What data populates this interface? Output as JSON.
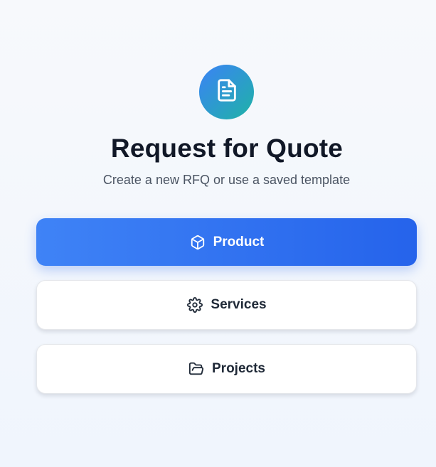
{
  "header": {
    "logo_icon": "document-icon",
    "title": "Request for Quote",
    "subtitle": "Create a new RFQ or use a saved template"
  },
  "options": [
    {
      "label": "Product",
      "icon": "package-icon",
      "style": "primary"
    },
    {
      "label": "Services",
      "icon": "gear-icon",
      "style": "secondary"
    },
    {
      "label": "Projects",
      "icon": "folder-open-icon",
      "style": "secondary"
    }
  ],
  "colors": {
    "primary_start": "#3f83f6",
    "primary_end": "#2563eb",
    "logo_start": "#3b82f6",
    "logo_end": "#1fb3a6",
    "title": "#111827",
    "subtitle": "#4b5563"
  }
}
